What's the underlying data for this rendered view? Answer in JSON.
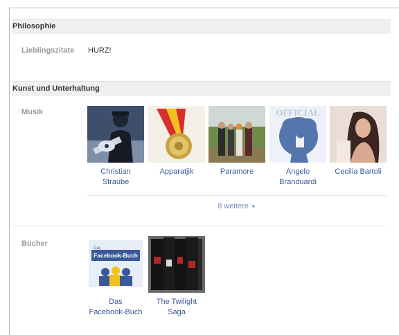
{
  "philosophy": {
    "header": "Philosophie",
    "quotes_label": "Lieblingszitate",
    "quotes_value": "HURZ!"
  },
  "entertainment": {
    "header": "Kunst und Unterhaltung",
    "music_label": "Musik",
    "music": [
      {
        "line1": "Christian",
        "line2": "Straube"
      },
      {
        "line1": "Apparatjik",
        "line2": ""
      },
      {
        "line1": "Paramore",
        "line2": ""
      },
      {
        "line1": "Angelo",
        "line2": "Branduardi"
      },
      {
        "line1": "Cecilia Bartoli",
        "line2": ""
      }
    ],
    "more_link": "8 weitere",
    "more_arrow": "▼",
    "books_label": "Bücher",
    "books": [
      {
        "line1": "Das",
        "line2": "Facebook-Buch"
      },
      {
        "line1": "The Twilight",
        "line2": "Saga"
      }
    ],
    "book_cover_text": {
      "small": "Das",
      "main": "Facebook-Buch"
    }
  },
  "image_text": {
    "official": "OFFICIAL"
  }
}
